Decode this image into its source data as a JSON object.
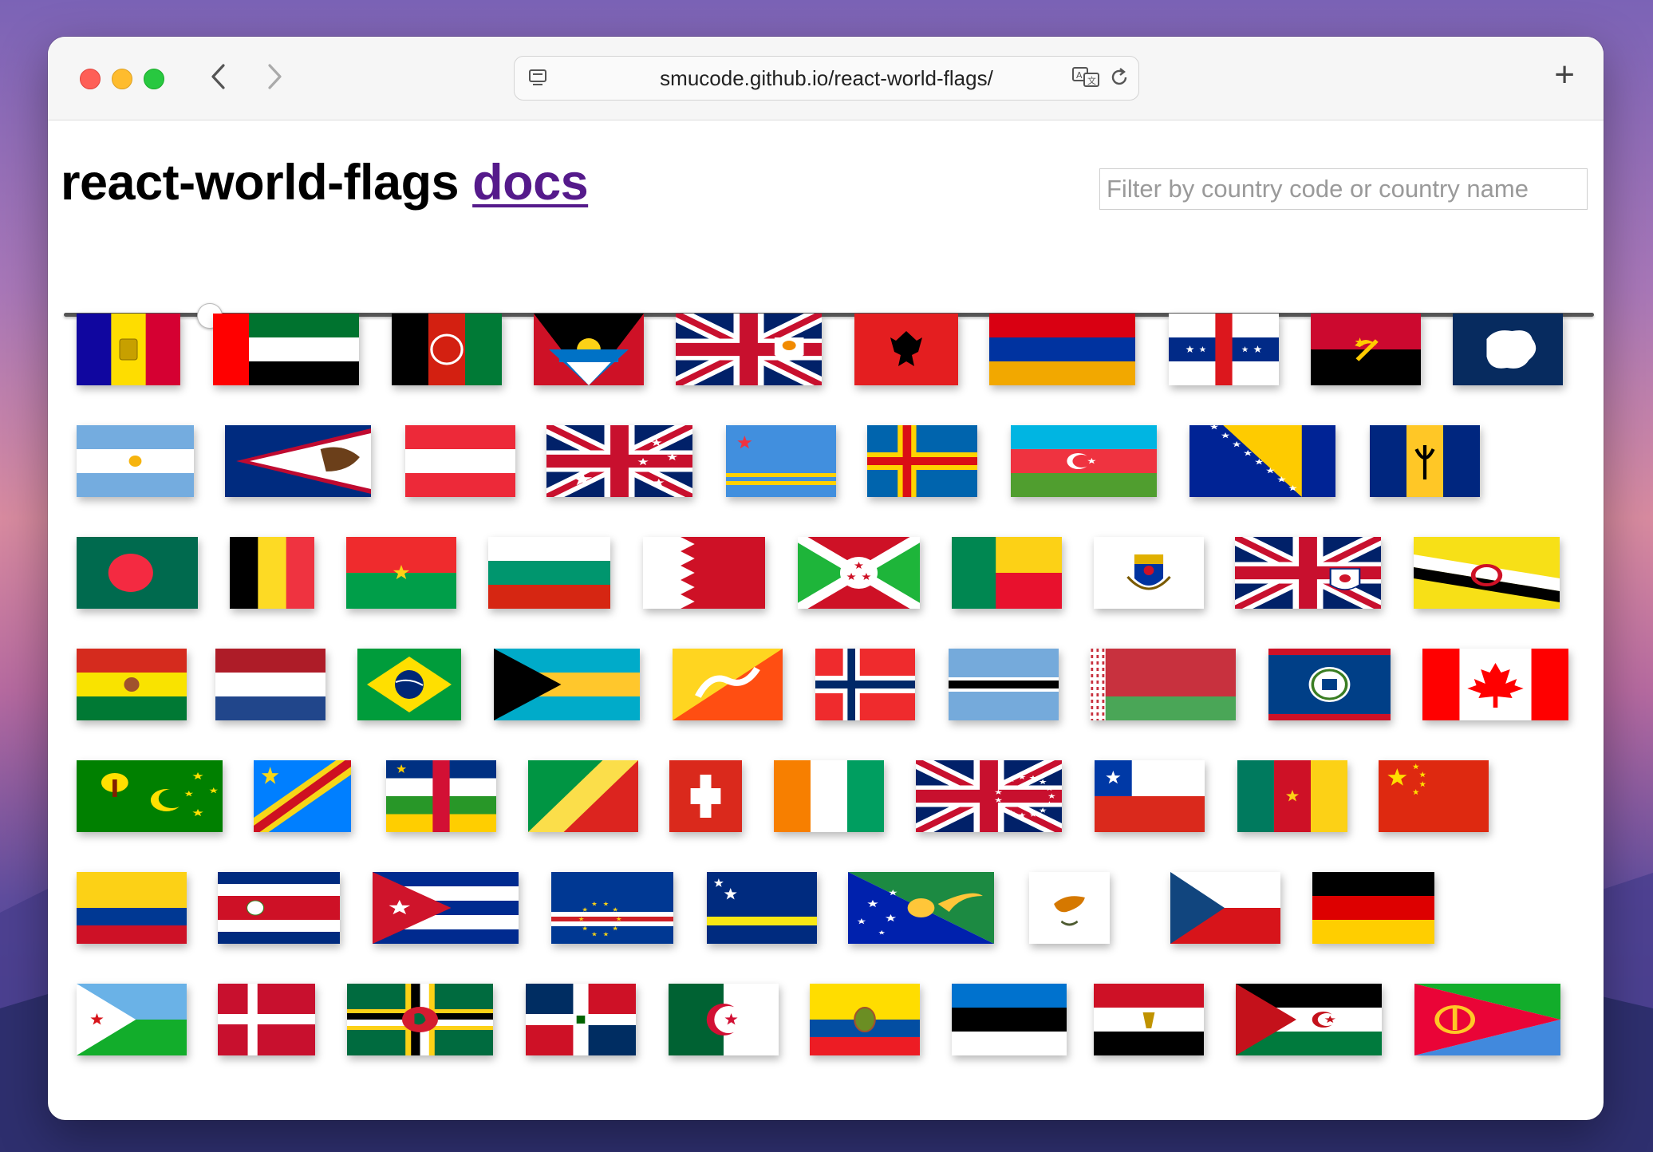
{
  "browser": {
    "url": "smucode.github.io/react-world-flags/",
    "icons": [
      "back-icon",
      "forward-icon",
      "page-icon",
      "translate-icon",
      "reload-icon",
      "new-tab-icon"
    ]
  },
  "page": {
    "title": "react-world-flags",
    "docs_link": "docs",
    "filter_placeholder": "Filter by country code or country name",
    "size_slider_value": 0.1
  },
  "flags": [
    [
      "AD",
      "AE",
      "AF",
      "AG",
      "AI",
      "AL",
      "AM",
      "AN",
      "AO",
      "AQ"
    ],
    [
      "AR",
      "AS",
      "AT",
      "AU",
      "AW",
      "AX",
      "AZ",
      "BA",
      "BB"
    ],
    [
      "BD",
      "BE",
      "BF",
      "BG",
      "BH",
      "BI",
      "BJ",
      "BL",
      "BM",
      "BN"
    ],
    [
      "BO",
      "BQ",
      "BR",
      "BS",
      "BT",
      "BV",
      "BW",
      "BY",
      "BZ",
      "CA"
    ],
    [
      "CC",
      "CD",
      "CF",
      "CG",
      "CH",
      "CI",
      "CK",
      "CL",
      "CM",
      "CN"
    ],
    [
      "CO",
      "CR",
      "CU",
      "CV",
      "CW",
      "CX",
      "CY",
      "CZ",
      "DE"
    ],
    [
      "DJ",
      "DK",
      "DM",
      "DO",
      "DZ",
      "EC",
      "EE",
      "EG",
      "EH",
      "ER"
    ]
  ]
}
